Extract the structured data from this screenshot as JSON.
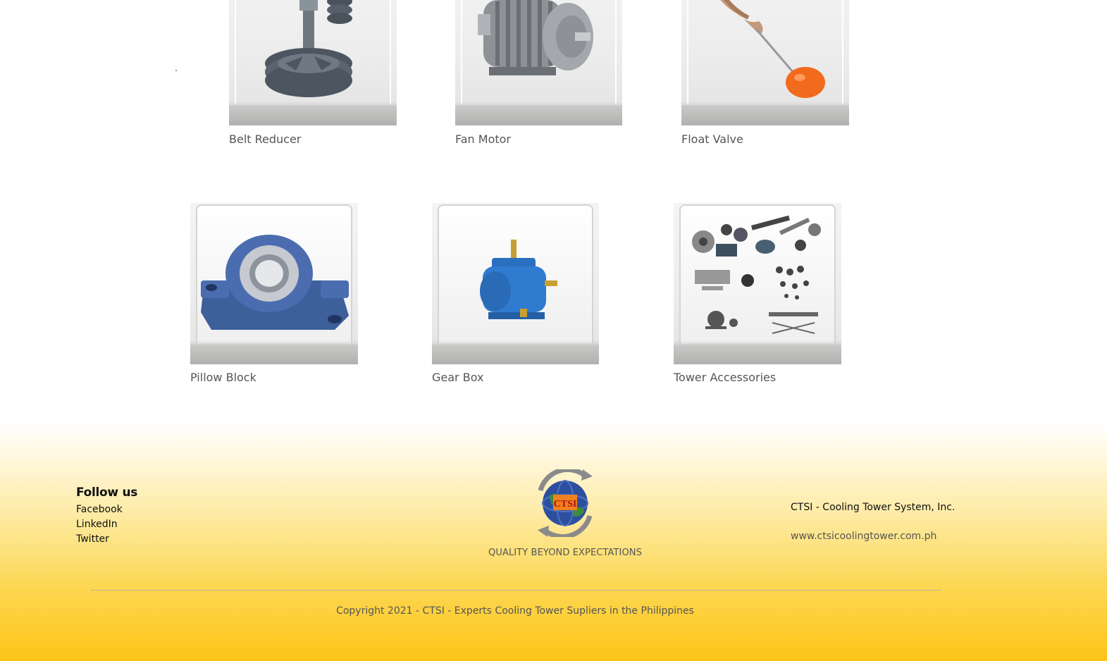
{
  "products": [
    {
      "name": "Belt Reducer",
      "icon": "belt-reducer-image"
    },
    {
      "name": "Fan Motor",
      "icon": "fan-motor-image"
    },
    {
      "name": "Float Valve",
      "icon": "float-valve-image"
    },
    {
      "name": "Pillow Block",
      "icon": "pillow-block-image"
    },
    {
      "name": "Gear Box",
      "icon": "gear-box-image"
    },
    {
      "name": "Tower Accessories",
      "icon": "tower-accessories-image"
    }
  ],
  "footer": {
    "follow_heading": "Follow us",
    "social_links": [
      "Facebook",
      "LinkedIn",
      "Twitter"
    ],
    "logo_text": "CTSI",
    "tagline": "QUALITY BEYOND EXPECTATIONS",
    "company_name": "CTSI - Cooling Tower System, Inc.",
    "website": "www.ctsicoolingtower.com.ph",
    "copyright": "Copyright 2021 - CTSI - Experts Cooling Tower Supliers in the Philippines"
  },
  "colors": {
    "footer_gradient_top": "#ffffff",
    "footer_gradient_bottom": "#fdc417",
    "label_text": "#555555"
  }
}
